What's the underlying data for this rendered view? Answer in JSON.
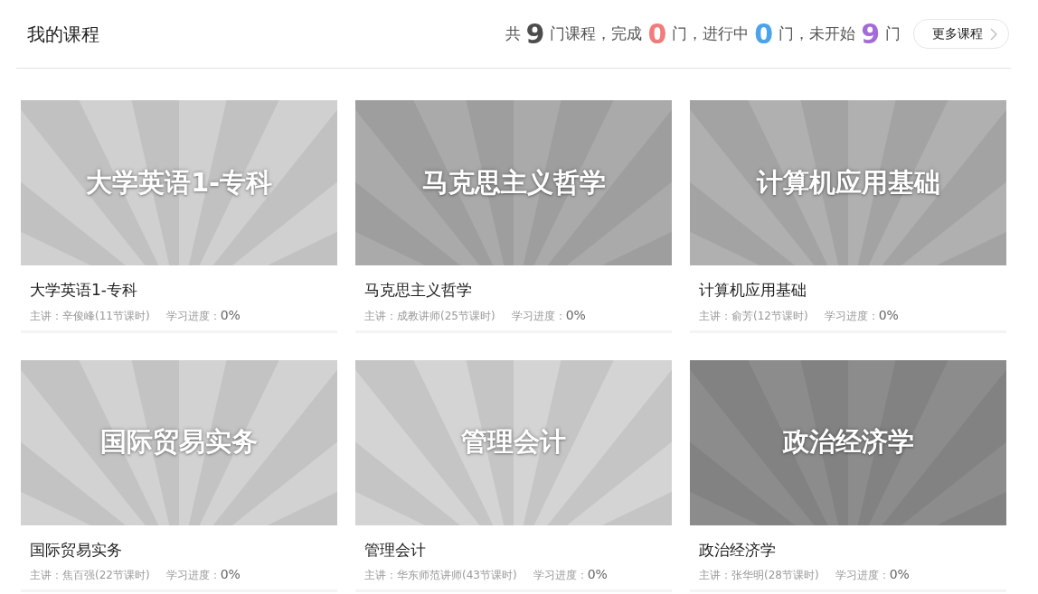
{
  "header": {
    "title": "我的课程",
    "summary": [
      {
        "label": "共",
        "count": "9",
        "color": "#4d4d4d"
      },
      {
        "label": "门课程，完成",
        "count": "0",
        "color": "#f27b7b"
      },
      {
        "label": "门，进行中",
        "count": "0",
        "color": "#4aa3ec"
      },
      {
        "label": "门，未开始",
        "count": "9",
        "color": "#a36bd8"
      }
    ],
    "summary_end": "门",
    "more_button": "更多课程"
  },
  "courses": [
    {
      "cover_title": "大学英语1-专科",
      "color": "#d0d0d0",
      "name": "大学英语1-专科",
      "teacher": "主讲：辛俊峰(11节课时)",
      "progress_label": "学习进度：",
      "progress": "0%"
    },
    {
      "cover_title": "马克思主义哲学",
      "color": "#aaaaaa",
      "name": "马克思主义哲学",
      "teacher": "主讲：成教讲师(25节课时)",
      "progress_label": "学习进度：",
      "progress": "0%"
    },
    {
      "cover_title": "计算机应用基础",
      "color": "#b0b0b0",
      "name": "计算机应用基础",
      "teacher": "主讲：俞芳(12节课时)",
      "progress_label": "学习进度：",
      "progress": "0%"
    },
    {
      "cover_title": "国际贸易实务",
      "color": "#d2d2d2",
      "name": "国际贸易实务",
      "teacher": "主讲：焦百强(22节课时)",
      "progress_label": "学习进度：",
      "progress": "0%"
    },
    {
      "cover_title": "管理会计",
      "color": "#d4d4d4",
      "name": "管理会计",
      "teacher": "主讲：华东师范讲师(43节课时)",
      "progress_label": "学习进度：",
      "progress": "0%"
    },
    {
      "cover_title": "政治经济学",
      "color": "#8c8c8c",
      "name": "政治经济学",
      "teacher": "主讲：张华明(28节课时)",
      "progress_label": "学习进度：",
      "progress": "0%"
    }
  ]
}
